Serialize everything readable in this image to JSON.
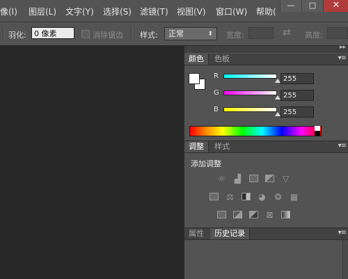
{
  "menu": {
    "items": [
      "像(I)",
      "图层(L)",
      "文字(Y)",
      "选择(S)",
      "滤镜(T)",
      "视图(V)",
      "窗口(W)",
      "帮助("
    ],
    "window_controls": [
      "—",
      "□",
      "✕"
    ]
  },
  "options_bar": {
    "feather_label": "羽化:",
    "feather_value": "0 像素",
    "antialias_label": "消除锯齿",
    "style_label": "样式:",
    "style_value": "正常",
    "width_label": "宽度:",
    "swap_icon": "⇄",
    "height_label": "高度:"
  },
  "color_panel": {
    "tabs": [
      "颜色",
      "色板"
    ],
    "channels": [
      {
        "name": "R",
        "value": "255",
        "gradient_from": "#00ffff",
        "gradient_to": "#ffffff"
      },
      {
        "name": "G",
        "value": "255",
        "gradient_from": "#ff00ff",
        "gradient_to": "#ffffff"
      },
      {
        "name": "B",
        "value": "255",
        "gradient_from": "#ffff00",
        "gradient_to": "#ffffff"
      }
    ],
    "foreground": "#ffffff",
    "background": "#ffffff"
  },
  "adjustments_panel": {
    "tabs": [
      "调整",
      "样式"
    ],
    "title": "添加调整",
    "icons": [
      [
        "brightness-icon",
        "levels-icon",
        "curves-icon",
        "exposure-icon",
        "vibrance-icon"
      ],
      [
        "hue-saturation-icon",
        "color-balance-icon",
        "black-white-icon",
        "photo-filter-icon",
        "channel-mixer-icon",
        "color-lookup-icon"
      ],
      [
        "invert-icon",
        "posterize-icon",
        "threshold-icon",
        "selective-color-icon",
        "gradient-map-icon"
      ]
    ]
  },
  "history_panel": {
    "tabs": [
      "属性",
      "历史记录"
    ]
  },
  "panel_menu_glyph": "▾≡",
  "dock_collapse_glyph": "▸▸"
}
